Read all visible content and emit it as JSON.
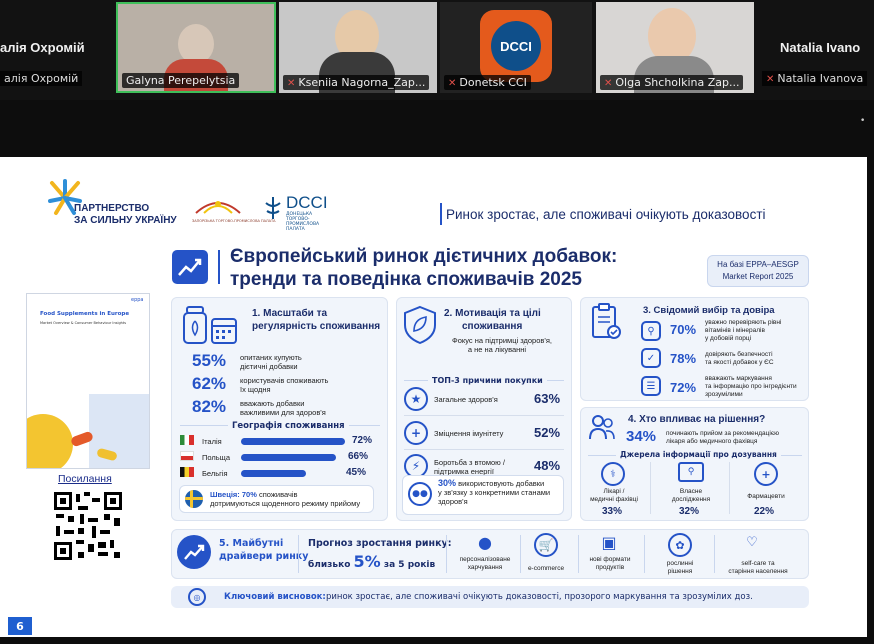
{
  "participants": {
    "left_name_big": "алія Охромій",
    "left_name_tag": "алія Охромій",
    "tiles": [
      {
        "name": "Galyna Perepelytsia",
        "muted": false
      },
      {
        "name": "Kseniia Nagorna_Zap...",
        "muted": true
      },
      {
        "name": "Donetsk CCI",
        "muted": true
      },
      {
        "name": "Olga Shcholkina Zap...",
        "muted": true
      }
    ],
    "right_name_big": "Natalia Ivano",
    "right_name_tag": "Natalia Ivanova",
    "mic_icon": "🎙"
  },
  "slide": {
    "page_number": "6",
    "logo_partnership_line1": "ПАРТНЕРСТВО",
    "logo_partnership_line2": "ЗА СИЛЬНУ УКРАЇНУ",
    "logo_chamber_text": "ЗАПОРІЗЬКА ТОРГОВО-ПРОМИСЛОВА ПАЛАТА",
    "logo_dcci": "DCCI",
    "logo_dcci_sub": "ДОНЕЦЬКА ТОРГОВО-ПРОМИСЛОВА ПАЛАТА",
    "tagline": "Ринок зростає, але споживачі очікують доказовості",
    "title_line1": "Європейський ринок дієтичних добавок:",
    "title_line2": "тренди та поведінка споживачів 2025",
    "source_line1": "На базі EPPA–AESGP",
    "source_line2": "Market Report 2025",
    "report_title": "Food Supplements in Europe",
    "report_sub": "Market Overview & Consumer Behaviour Insights",
    "report_brand": "eppa",
    "links_label": "Посилання",
    "s1": {
      "title_line1": "1. Масштаби та",
      "title_line2": "регулярність споживання",
      "stats": [
        {
          "pct": "55%",
          "line1": "опитаних купують",
          "line2": "дієтичні добавки"
        },
        {
          "pct": "62%",
          "line1": "користувачів споживають",
          "line2": "їх щодня"
        },
        {
          "pct": "82%",
          "line1": "вважають добавки",
          "line2": "важливими для здоров'я"
        }
      ],
      "geo_title": "Географія споживання",
      "countries": [
        {
          "name": "Італія",
          "value": 72,
          "label": "72%"
        },
        {
          "name": "Польща",
          "value": 66,
          "label": "66%"
        },
        {
          "name": "Бельгія",
          "value": 45,
          "label": "45%"
        }
      ],
      "sweden_bold": "Швеція: 70%",
      "sweden_rest": " споживачів",
      "sweden_line2": "дотримуються щоденного режиму прийому"
    },
    "s2": {
      "title_line1": "2. Мотивація та цілі",
      "title_line2": "споживання",
      "sub_line1": "Фокус на підтримці здоров'я,",
      "sub_line2": "а не на лікуванні",
      "top_title": "ТОП-3 причини покупки",
      "reasons": [
        {
          "line1": "Загальне здоров'я",
          "line2": "",
          "pct": "63%"
        },
        {
          "line1": "Зміцнення імунітету",
          "line2": "",
          "pct": "52%"
        },
        {
          "line1": "Боротьба з втомою /",
          "line2": "підтримка енергії",
          "pct": "48%"
        }
      ],
      "note_bold": "30%",
      "note_line1": " використовують добавки",
      "note_line2": "у зв'язку з конкретними станами",
      "note_line3": "здоров'я"
    },
    "s3": {
      "title": "3. Свідомий вибір та довіра",
      "items": [
        {
          "pct": "70%",
          "line1": "уважно перевіряють рівні",
          "line2": "вітамінів і мінералів",
          "line3": "у добовій порці"
        },
        {
          "pct": "78%",
          "line1": "довіряють безпечності",
          "line2": "та якості добавок у ЄС",
          "line3": ""
        },
        {
          "pct": "72%",
          "line1": "вважають маркування",
          "line2": "та інформацію про інгредієнти",
          "line3": "зрозумілими"
        }
      ]
    },
    "s4": {
      "title": "4. Хто впливає на рішення?",
      "pct": "34%",
      "desc_line1": "починають прийом за рекомендацією",
      "desc_line2": "лікаря або медичного фахівця",
      "sources_title": "Джерела інформації про дозування",
      "sources": [
        {
          "line1": "Лікарі /",
          "line2": "медичні фахівці",
          "pct": "33%"
        },
        {
          "line1": "Власне",
          "line2": "дослідження",
          "pct": "32%"
        },
        {
          "line1": "Фармацевти",
          "line2": "",
          "pct": "22%"
        }
      ]
    },
    "s5": {
      "title_line1": "5. Майбутні",
      "title_line2": "драйвери ринку",
      "forecast_title": "Прогноз зростання ринку:",
      "forecast_pre": "близько",
      "forecast_pct": "5%",
      "forecast_post": "за 5 років",
      "drivers": [
        {
          "line1": "персоналізоване",
          "line2": "харчування"
        },
        {
          "line1": "e-commerce",
          "line2": ""
        },
        {
          "line1": "нові формати",
          "line2": "продуктів"
        },
        {
          "line1": "рослинні",
          "line2": "рішення"
        },
        {
          "line1": "self-care та",
          "line2": "старіння населення"
        }
      ]
    },
    "conclusion_label": "Ключовий висновок:",
    "conclusion_text": "ринок зростає, але споживачі очікують доказовості, прозорого маркування та зрозумілих доз."
  }
}
